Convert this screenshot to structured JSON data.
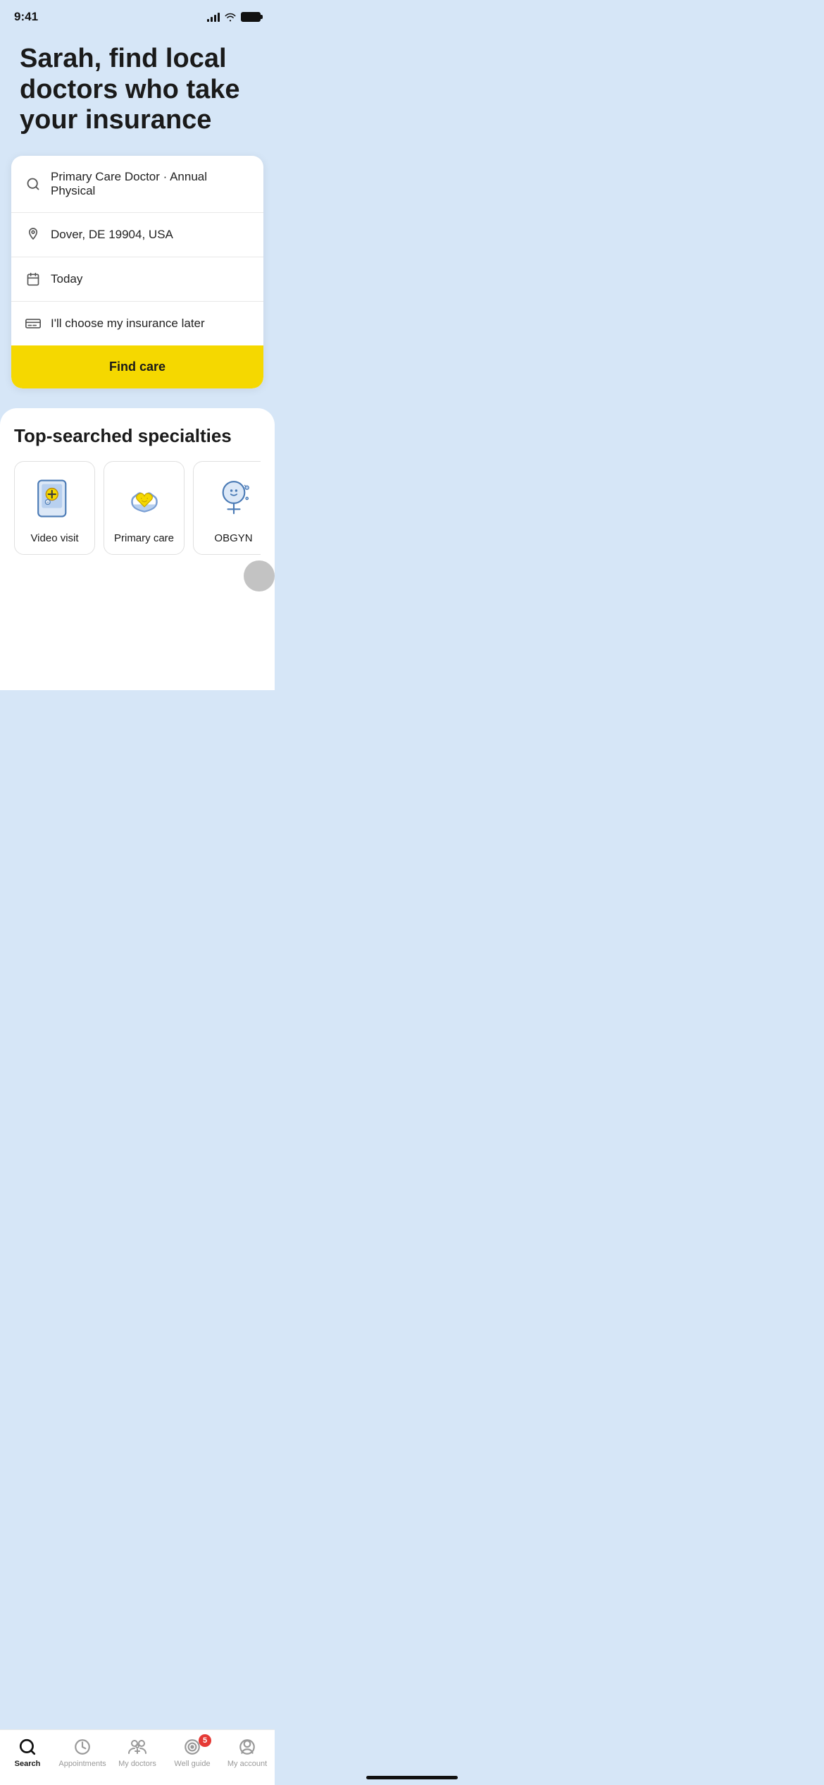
{
  "status": {
    "time": "9:41"
  },
  "header": {
    "title": "Sarah, find local doctors who take your insurance"
  },
  "search_form": {
    "specialty_row": "Primary Care Doctor · Annual Physical",
    "location_row": "Dover, DE 19904, USA",
    "date_row": "Today",
    "insurance_row": "I'll choose my insurance later",
    "find_care_label": "Find care"
  },
  "specialties": {
    "section_title": "Top-searched specialties",
    "items": [
      {
        "label": "Video visit"
      },
      {
        "label": "Primary care"
      },
      {
        "label": "OBGYN"
      }
    ]
  },
  "bottom_nav": {
    "items": [
      {
        "label": "Search",
        "active": true
      },
      {
        "label": "Appointments",
        "active": false
      },
      {
        "label": "My doctors",
        "active": false
      },
      {
        "label": "Well guide",
        "active": false,
        "badge": "5"
      },
      {
        "label": "My account",
        "active": false
      }
    ]
  }
}
